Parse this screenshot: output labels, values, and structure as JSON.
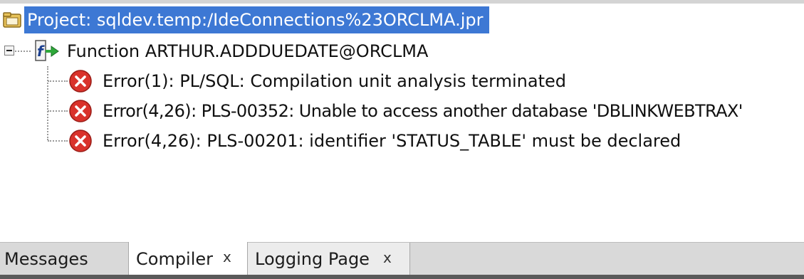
{
  "tree": {
    "project": {
      "label": "Project: sqldev.temp:/IdeConnections%23ORCLMA.jpr",
      "icon": "project-folder-icon"
    },
    "function": {
      "label": "Function ARTHUR.ADDDUEDATE@ORCLMA",
      "icon": "function-icon",
      "expanded": true
    },
    "errors": [
      {
        "label": "Error(1): PL/SQL: Compilation unit analysis terminated",
        "icon": "error-icon"
      },
      {
        "label": "Error(4,26): PLS-00352: Unable to access another database 'DBLINKWEBTRAX'",
        "icon": "error-icon"
      },
      {
        "label": "Error(4,26): PLS-00201: identifier 'STATUS_TABLE' must be declared",
        "icon": "error-icon"
      }
    ]
  },
  "tabs": [
    {
      "label": "Messages",
      "active": false,
      "closable": false
    },
    {
      "label": "Compiler",
      "active": true,
      "closable": true,
      "close_glyph": "x"
    },
    {
      "label": "Logging Page",
      "active": false,
      "closable": true,
      "close_glyph": "x"
    }
  ],
  "colors": {
    "selection": "#3d78d4",
    "error": "#d9322b",
    "tab_active": "#ffffff",
    "tab_inactive": "#d9d9d9"
  }
}
